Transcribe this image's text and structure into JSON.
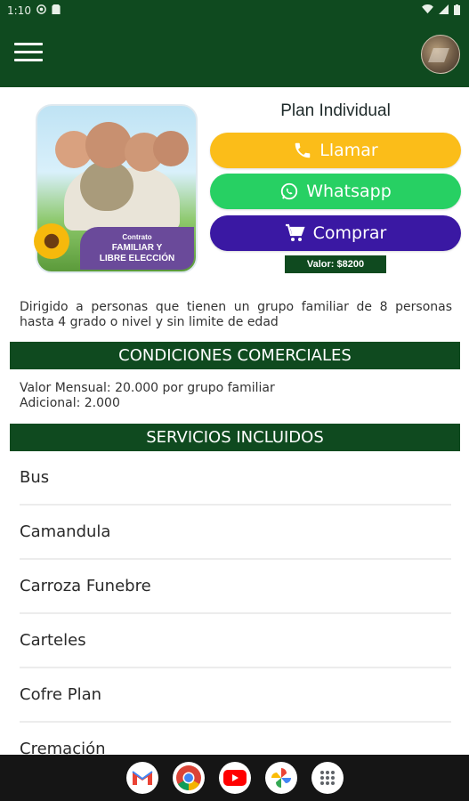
{
  "status_bar": {
    "time": "1:10",
    "icons": [
      "wifi-icon",
      "signal-icon",
      "battery-icon"
    ]
  },
  "app_bar": {
    "menu_icon": "hamburger-icon",
    "avatar": "avatar"
  },
  "hero": {
    "banner_line1": "Contrato",
    "banner_line2": "FAMILIAR Y",
    "banner_line3": "LIBRE ELECCIÓN"
  },
  "plan": {
    "title": "Plan Individual",
    "call_label": "Llamar",
    "whatsapp_label": "Whatsapp",
    "buy_label": "Comprar",
    "price": "Valor: $8200"
  },
  "description": "Dirigido a personas que tienen un grupo familiar de 8 personas hasta 4 grado o nivel y sin limite de edad",
  "conditions": {
    "title": "CONDICIONES COMERCIALES",
    "line1": "Valor Mensual: 20.000 por grupo familiar",
    "line2": "Adicional: 2.000"
  },
  "services": {
    "title": "SERVICIOS INCLUIDOS",
    "items": [
      "Bus",
      "Camandula",
      "Carroza Funebre",
      "Carteles",
      "Cofre Plan",
      "Cremación"
    ]
  },
  "colors": {
    "primary": "#0f4a1f",
    "call": "#fbbd19",
    "whatsapp": "#27d063",
    "buy": "#3a18a3"
  },
  "dock": [
    "gmail-icon",
    "chrome-icon",
    "youtube-icon",
    "photos-icon",
    "apps-icon"
  ]
}
